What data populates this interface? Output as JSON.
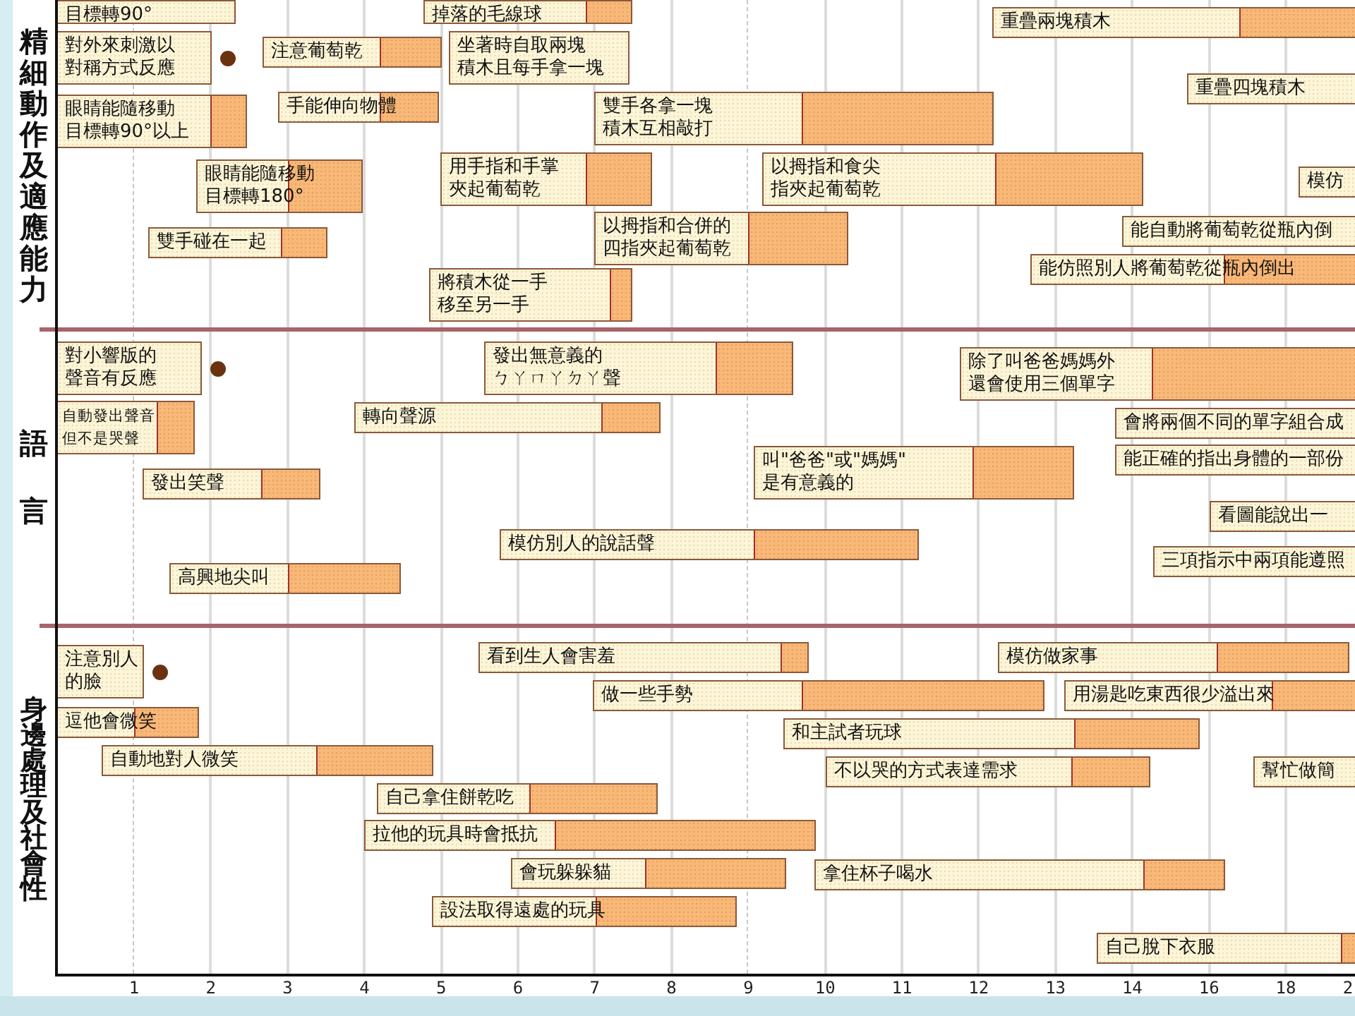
{
  "sections": [
    {
      "label": "精細動作及適應能力",
      "items": [
        {
          "text": "目標轉90°",
          "marked": false
        },
        {
          "text": "掉落的毛線球",
          "marked": false
        },
        {
          "text": "對外來刺激以對稱方式反應",
          "marked": true
        },
        {
          "text": "注意葡萄乾",
          "marked": false
        },
        {
          "text": "坐著時自取兩塊積木且每手拿一塊",
          "marked": false
        },
        {
          "text": "眼睛能隨移動目標轉90°以上",
          "marked": false
        },
        {
          "text": "手能伸向物體",
          "marked": false
        },
        {
          "text": "雙手各拿一塊積木互相敲打",
          "marked": false
        },
        {
          "text": "重疊兩塊積木",
          "marked": false
        },
        {
          "text": "重疊四塊積木",
          "marked": false
        },
        {
          "text": "眼睛能隨移動目標轉180°",
          "marked": false
        },
        {
          "text": "用手指和手掌夾起葡萄乾",
          "marked": false
        },
        {
          "text": "以拇指和食尖指夾起葡萄乾",
          "marked": false
        },
        {
          "text": "模仿",
          "marked": false
        },
        {
          "text": "雙手碰在一起",
          "marked": false
        },
        {
          "text": "以拇指和合併的四指夾起葡萄乾",
          "marked": false
        },
        {
          "text": "能自動將葡萄乾從瓶內倒",
          "marked": false
        },
        {
          "text": "能仿照別人將葡萄乾從瓶內倒出",
          "marked": false
        },
        {
          "text": "將積木從一手移至另一手",
          "marked": false
        }
      ]
    },
    {
      "label": "語言",
      "items": [
        {
          "text": "對小響版的聲音有反應",
          "marked": true
        },
        {
          "text": "發出無意義的ㄅㄚㄇㄚㄉㄚ聲",
          "marked": false
        },
        {
          "text": "除了叫爸爸媽媽外還會使用三個單字",
          "marked": false
        },
        {
          "text": "自動發出聲音但不是哭聲",
          "marked": false
        },
        {
          "text": "轉向聲源",
          "marked": false
        },
        {
          "text": "會將兩個不同的單字組合成",
          "marked": false
        },
        {
          "text": "能正確的指出身體的一部份",
          "marked": false
        },
        {
          "text": "發出笑聲",
          "marked": false
        },
        {
          "text": "叫\"爸爸\"或\"媽媽\"是有意義的",
          "marked": false
        },
        {
          "text": "看圖能說出一",
          "marked": false
        },
        {
          "text": "模仿別人的說話聲",
          "marked": false
        },
        {
          "text": "三項指示中兩項能遵照",
          "marked": false
        },
        {
          "text": "高興地尖叫",
          "marked": false
        }
      ]
    },
    {
      "label": "身邊處理及社會性",
      "items": [
        {
          "text": "注意別人的臉",
          "marked": true
        },
        {
          "text": "看到生人會害羞",
          "marked": false
        },
        {
          "text": "模仿做家事",
          "marked": false
        },
        {
          "text": "做一些手勢",
          "marked": false
        },
        {
          "text": "用湯匙吃東西很少溢出來",
          "marked": false
        },
        {
          "text": "逗他會微笑",
          "marked": false
        },
        {
          "text": "和主試者玩球",
          "marked": false
        },
        {
          "text": "自動地對人微笑",
          "marked": false
        },
        {
          "text": "不以哭的方式表達需求",
          "marked": false
        },
        {
          "text": "幫忙做簡",
          "marked": false
        },
        {
          "text": "自己拿住餅乾吃",
          "marked": false
        },
        {
          "text": "拉他的玩具時會抵抗",
          "marked": false
        },
        {
          "text": "會玩躲躲貓",
          "marked": false
        },
        {
          "text": "拿住杯子喝水",
          "marked": false
        },
        {
          "text": "設法取得遠處的玩具",
          "marked": false
        },
        {
          "text": "自己脫下衣服",
          "marked": false
        }
      ]
    }
  ],
  "axis": {
    "ticks": [
      "1",
      "2",
      "3",
      "4",
      "5",
      "6",
      "7",
      "8",
      "9",
      "10",
      "11",
      "12",
      "13",
      "14",
      "16",
      "18",
      "2"
    ]
  }
}
